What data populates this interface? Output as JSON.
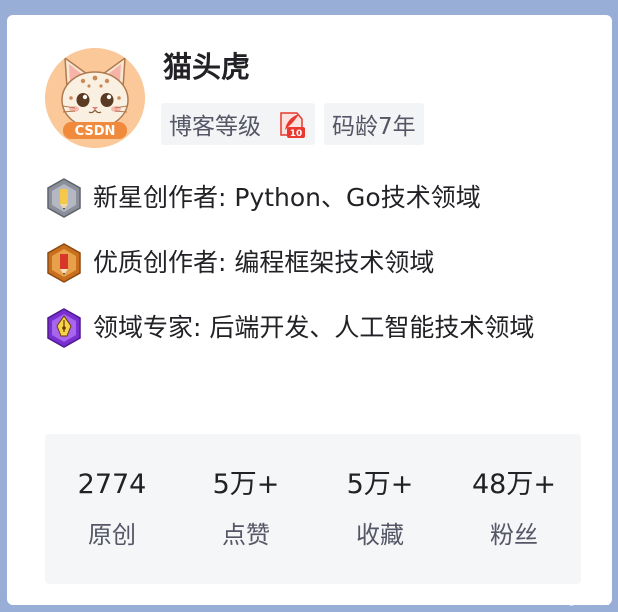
{
  "profile": {
    "username": "猫头虎",
    "avatar_badge_text": "CSDN",
    "tags": [
      {
        "label": "博客等级",
        "level_icon": "blog-level-10-icon",
        "level_value": "10"
      },
      {
        "label": "码龄7年"
      }
    ]
  },
  "badges": [
    {
      "icon": "new-star-creator-icon",
      "text": "新星创作者: Python、Go技术领域"
    },
    {
      "icon": "quality-creator-icon",
      "text": "优质创作者: 编程框架技术领域"
    },
    {
      "icon": "domain-expert-icon",
      "text": "领域专家: 后端开发、人工智能技术领域"
    }
  ],
  "stats": [
    {
      "value": "2774",
      "label": "原创"
    },
    {
      "value": "5万+",
      "label": "点赞"
    },
    {
      "value": "5万+",
      "label": "收藏"
    },
    {
      "value": "48万+",
      "label": "粉丝"
    }
  ],
  "watermark": "CSDN @猫头虎",
  "colors": {
    "page_background": "#98aed6",
    "card_background": "#ffffff",
    "stats_background": "#f5f6f7",
    "level_badge_red": "#e8382f",
    "new_star_badge": "#8a8f99",
    "quality_badge": "#c8701e",
    "expert_badge": "#7a2fd0"
  }
}
